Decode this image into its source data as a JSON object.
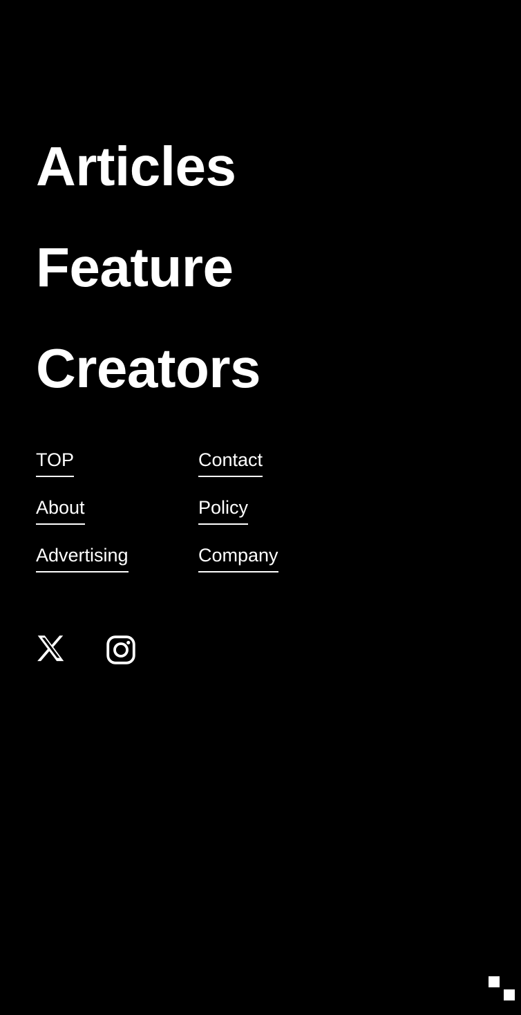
{
  "theme": {
    "background": "#000000",
    "foreground": "#ffffff"
  },
  "footer": {
    "headings": [
      {
        "label": "Articles"
      },
      {
        "label": "Feature"
      },
      {
        "label": "Creators"
      }
    ],
    "link_columns": [
      {
        "name": "left",
        "links": [
          {
            "label": "TOP"
          },
          {
            "label": "About"
          },
          {
            "label": "Advertising"
          }
        ]
      },
      {
        "name": "right",
        "links": [
          {
            "label": "Contact"
          },
          {
            "label": "Policy"
          },
          {
            "label": "Company"
          }
        ]
      }
    ],
    "social": [
      {
        "icon": "x-twitter-icon",
        "label": "X"
      },
      {
        "icon": "instagram-icon",
        "label": "Instagram"
      }
    ]
  },
  "corner": {
    "marks": [
      {
        "name": "upper-square"
      },
      {
        "name": "lower-square"
      }
    ]
  }
}
